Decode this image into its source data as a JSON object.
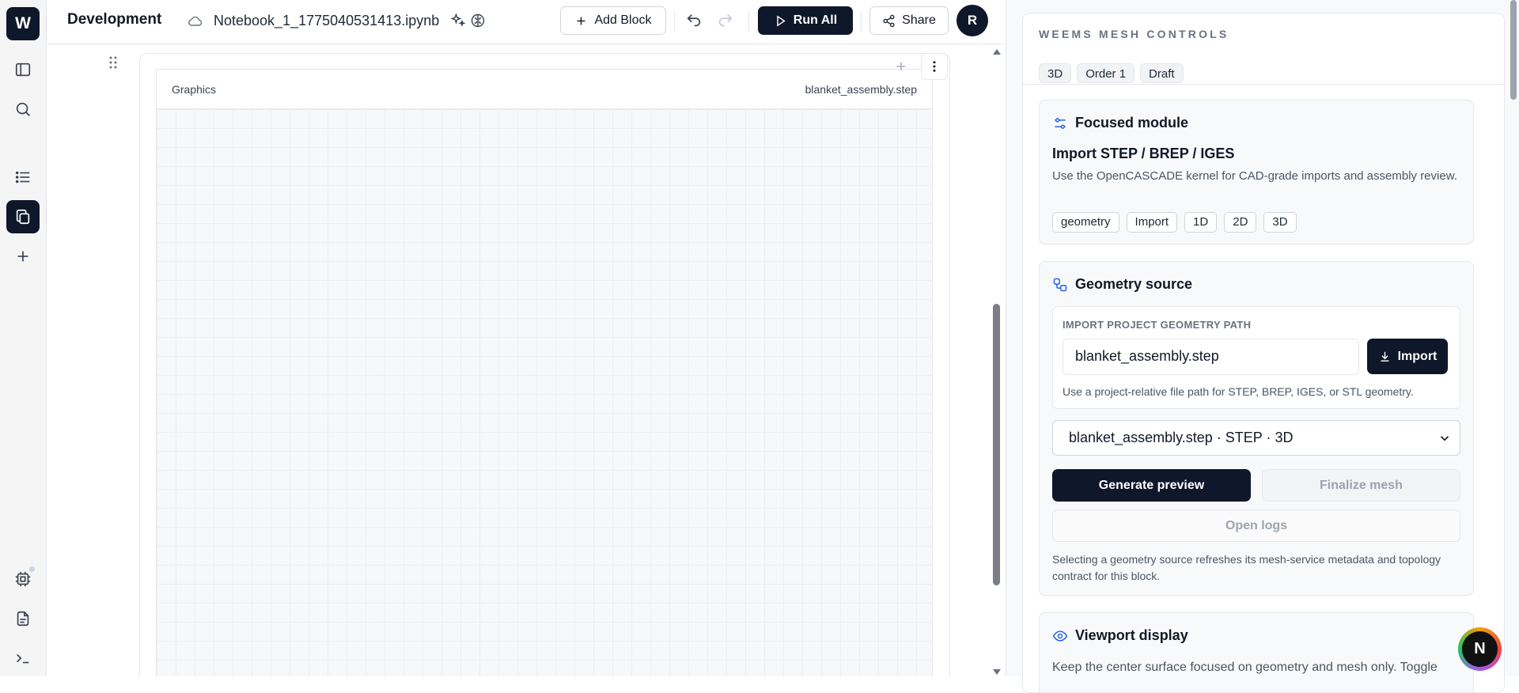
{
  "app": {
    "logo_letter": "W"
  },
  "topbar": {
    "title": "Development",
    "notebook_name": "Notebook_1_1775040531413.ipynb",
    "add_block_label": "Add Block",
    "run_all_label": "Run All",
    "share_label": "Share",
    "avatar_initial": "R"
  },
  "sidebar": {
    "items": [
      {
        "name": "sidebar-toggle",
        "icon": "panel-left-icon"
      },
      {
        "name": "search",
        "icon": "search-icon"
      },
      {
        "name": "outline",
        "icon": "list-icon"
      },
      {
        "name": "files",
        "icon": "copy-icon",
        "active": true
      },
      {
        "name": "add",
        "icon": "plus-icon"
      },
      {
        "name": "hardware",
        "icon": "cpu-icon"
      },
      {
        "name": "document",
        "icon": "file-text-icon"
      },
      {
        "name": "terminal",
        "icon": "terminal-icon"
      }
    ]
  },
  "cell": {
    "graphics_label": "Graphics",
    "file_label": "blanket_assembly.step"
  },
  "panel": {
    "title": "WEEMS MESH CONTROLS",
    "chips": [
      "3D",
      "Order 1",
      "Draft"
    ],
    "focused": {
      "heading": "Focused module",
      "title": "Import STEP / BREP / IGES",
      "description": "Use the OpenCASCADE kernel for CAD-grade imports and assembly review.",
      "tags": [
        "geometry",
        "Import",
        "1D",
        "2D",
        "3D"
      ]
    },
    "geometry": {
      "heading": "Geometry source",
      "path_label": "IMPORT PROJECT GEOMETRY PATH",
      "path_value": "blanket_assembly.step",
      "import_label": "Import",
      "hint": "Use a project-relative file path for STEP, BREP, IGES, or STL geometry.",
      "selected_source": "blanket_assembly.step · STEP · 3D",
      "generate_label": "Generate preview",
      "finalize_label": "Finalize mesh",
      "logs_label": "Open logs",
      "note": "Selecting a geometry source refreshes its mesh-service metadata and topology contract for this block."
    },
    "viewport": {
      "heading": "Viewport display",
      "description": "Keep the center surface focused on geometry and mesh only. Toggle"
    }
  },
  "fab": {
    "letter": "N"
  },
  "colors": {
    "accent": "#0f172a",
    "icon_blue": "#2563eb"
  }
}
